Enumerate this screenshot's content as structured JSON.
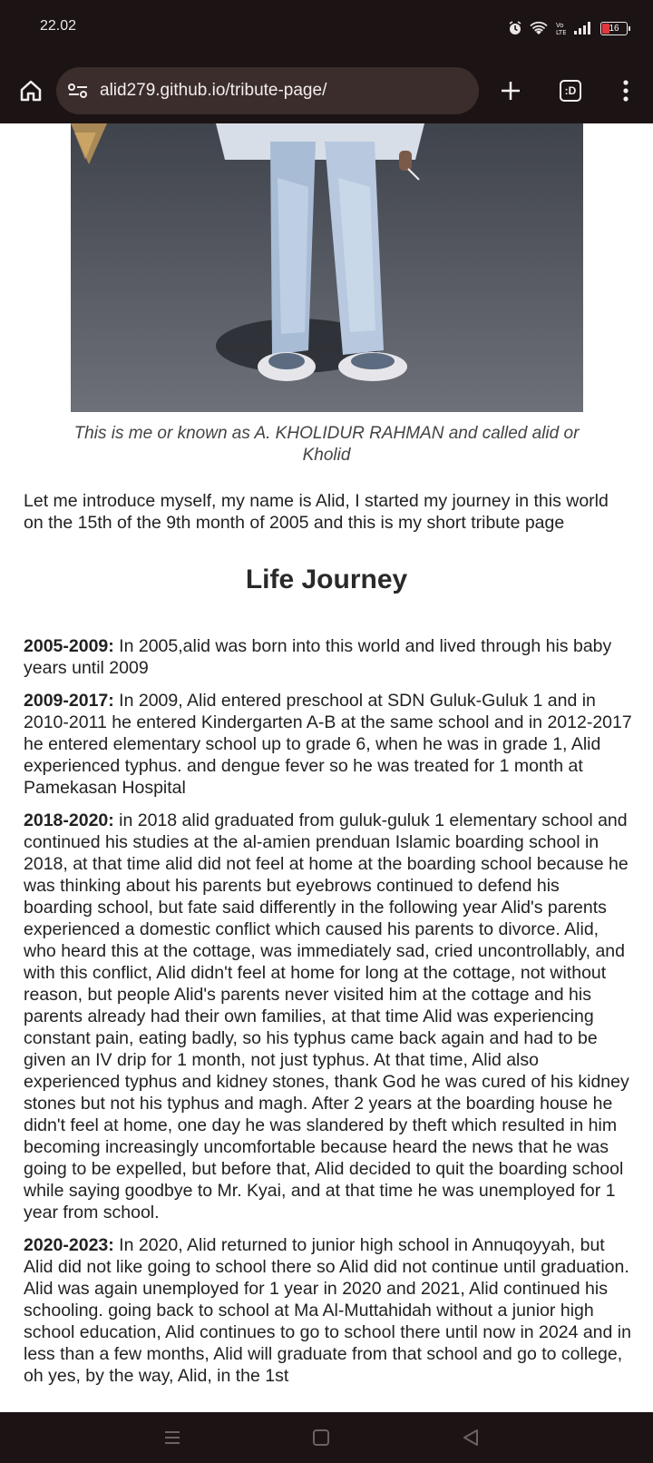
{
  "status_bar": {
    "time": "22.02",
    "battery_level": "16",
    "icons": [
      "alarm-icon",
      "wifi-icon",
      "volte-icon",
      "signal-icon",
      "battery-icon"
    ]
  },
  "browser": {
    "url": "alid279.github.io/tribute-page/",
    "tab_count": ":D",
    "icons": [
      "home-icon",
      "site-settings-icon",
      "plus-icon",
      "tabs-icon",
      "more-vert-icon"
    ]
  },
  "page": {
    "caption": "This is me or known as A. KHOLIDUR RAHMAN and called alid or Kholid",
    "intro": "Let me introduce myself, my name is Alid, I started my journey in this world on the 15th of the 9th month of 2005 and this is my short tribute page",
    "section_title": "Life Journey",
    "timeline": [
      {
        "years": "2005-2009:",
        "text": " In 2005,alid was born into this world and lived through his baby years until 2009"
      },
      {
        "years": "2009-2017:",
        "text": " In 2009, Alid entered preschool at SDN Guluk-Guluk 1 and in 2010-2011 he entered Kindergarten A-B at the same school and in 2012-2017 he entered elementary school up to grade 6, when he was in grade 1, Alid experienced typhus. and dengue fever so he was treated for 1 month at Pamekasan Hospital"
      },
      {
        "years": "2018-2020:",
        "text": " in 2018 alid graduated from guluk-guluk 1 elementary school and continued his studies at the al-amien prenduan Islamic boarding school in 2018, at that time alid did not feel at home at the boarding school because he was thinking about his parents but eyebrows continued to defend his boarding school, but fate said differently in the following year Alid's parents experienced a domestic conflict which caused his parents to divorce. Alid, who heard this at the cottage, was immediately sad, cried uncontrollably, and with this conflict, Alid didn't feel at home for long at the cottage, not without reason, but people Alid's parents never visited him at the cottage and his parents already had their own families, at that time Alid was experiencing constant pain, eating badly, so his typhus came back again and had to be given an IV drip for 1 month, not just typhus. At that time, Alid also experienced typhus and kidney stones, thank God he was cured of his kidney stones but not his typhus and magh. After 2 years at the boarding house he didn't feel at home, one day he was slandered by theft which resulted in him becoming increasingly uncomfortable because heard the news that he was going to be expelled, but before that, Alid decided to quit the boarding school while saying goodbye to Mr. Kyai, and at that time he was unemployed for 1 year from school."
      },
      {
        "years": "2020-2023:",
        "text": " In 2020, Alid returned to junior high school in Annuqoyyah, but Alid did not like going to school there so Alid did not continue until graduation. Alid was again unemployed for 1 year in 2020 and 2021, Alid continued his schooling. going back to school at Ma Al-Muttahidah without a junior high school education, Alid continues to go to school there until now in 2024 and in less than a few months, Alid will graduate from that school and go to college, oh yes, by the way, Alid, in the 1st"
      }
    ]
  },
  "nav_bar": {
    "icons": [
      "recents-icon",
      "home-nav-icon",
      "back-icon"
    ]
  }
}
